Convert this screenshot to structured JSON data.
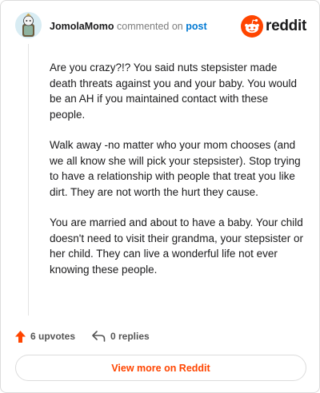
{
  "header": {
    "username": "JomolaMomo",
    "action_text": "commented on",
    "post_link": "post",
    "brand": "reddit"
  },
  "comment": {
    "paragraphs": [
      "Are you crazy?!? You said nuts stepsister made death threats against you and your baby. You would be an AH if you maintained contact with these people.",
      "Walk away -no matter who your mom chooses (and we all know she will pick your stepsister). Stop trying to have a relationship with people that treat you like dirt. They are not worth the hurt they cause.",
      "You are married and about to have a baby. Your child doesn't need to visit their grandma, your stepsister or her child. They can live a wonderful life not ever knowing these people."
    ]
  },
  "footer": {
    "upvotes_label": "6 upvotes",
    "replies_label": "0 replies",
    "view_more_label": "View more on Reddit"
  },
  "colors": {
    "accent": "#ff4500",
    "link": "#0079d3",
    "muted": "#7c7c7c"
  },
  "icons": {
    "avatar": "snoo-avatar",
    "brand": "reddit-logo-icon",
    "upvote": "upvote-arrow-icon",
    "reply": "reply-icon"
  }
}
